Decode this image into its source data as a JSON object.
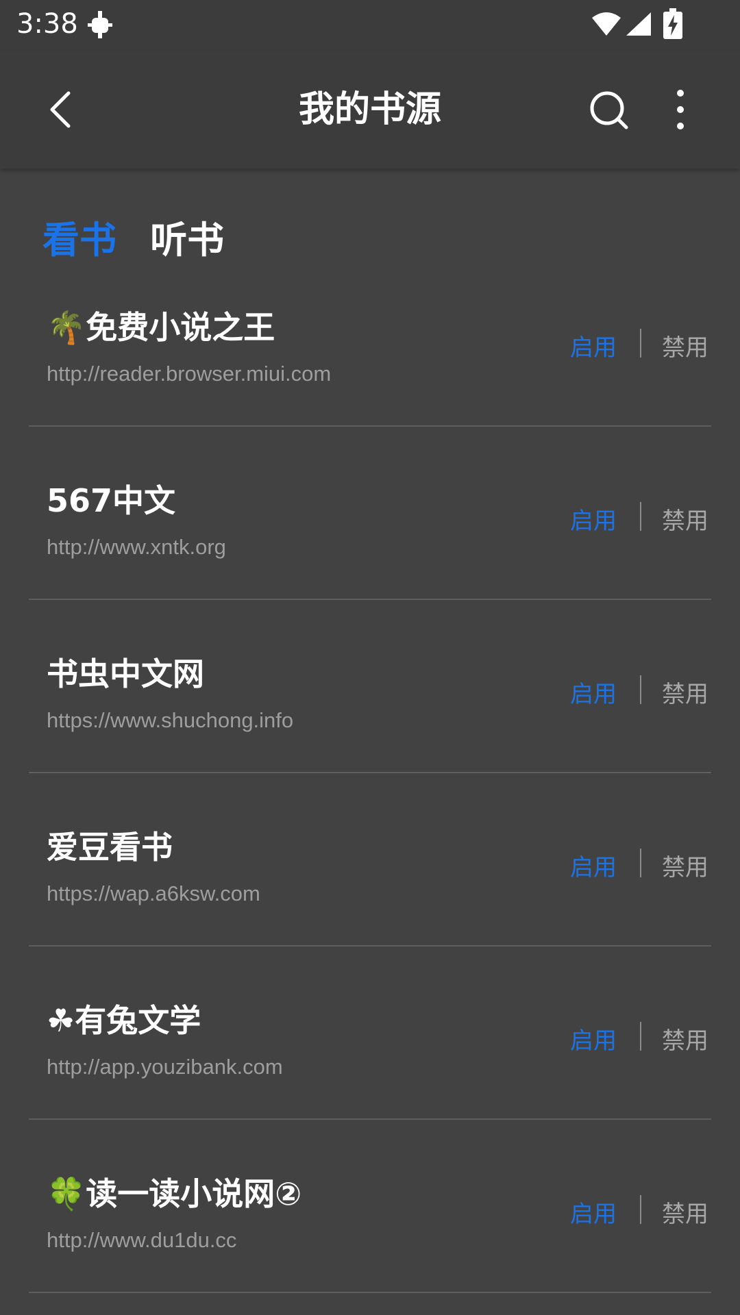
{
  "status_bar": {
    "time": "3:38"
  },
  "app_bar": {
    "title": "我的书源"
  },
  "tabs": [
    {
      "label": "看书",
      "active": true
    },
    {
      "label": "听书",
      "active": false
    }
  ],
  "sources": [
    {
      "name": "🌴免费小说之王",
      "url": "http://reader.browser.miui.com",
      "enable_label": "启用",
      "disable_label": "禁用"
    },
    {
      "name": "567中文",
      "url": "http://www.xntk.org",
      "enable_label": "启用",
      "disable_label": "禁用"
    },
    {
      "name": "书虫中文网",
      "url": "https://www.shuchong.info",
      "enable_label": "启用",
      "disable_label": "禁用"
    },
    {
      "name": "爱豆看书",
      "url": "https://wap.a6ksw.com",
      "enable_label": "启用",
      "disable_label": "禁用"
    },
    {
      "name": "☘有兔文学",
      "url": "http://app.youzibank.com",
      "enable_label": "启用",
      "disable_label": "禁用"
    },
    {
      "name": "🍀读一读小说网②",
      "url": "http://www.du1du.cc",
      "enable_label": "启用",
      "disable_label": "禁用"
    }
  ],
  "colors": {
    "accent": "#1a73e8",
    "background": "#424242",
    "bar": "#3c3c3c",
    "secondary_text": "#9e9e9e"
  }
}
